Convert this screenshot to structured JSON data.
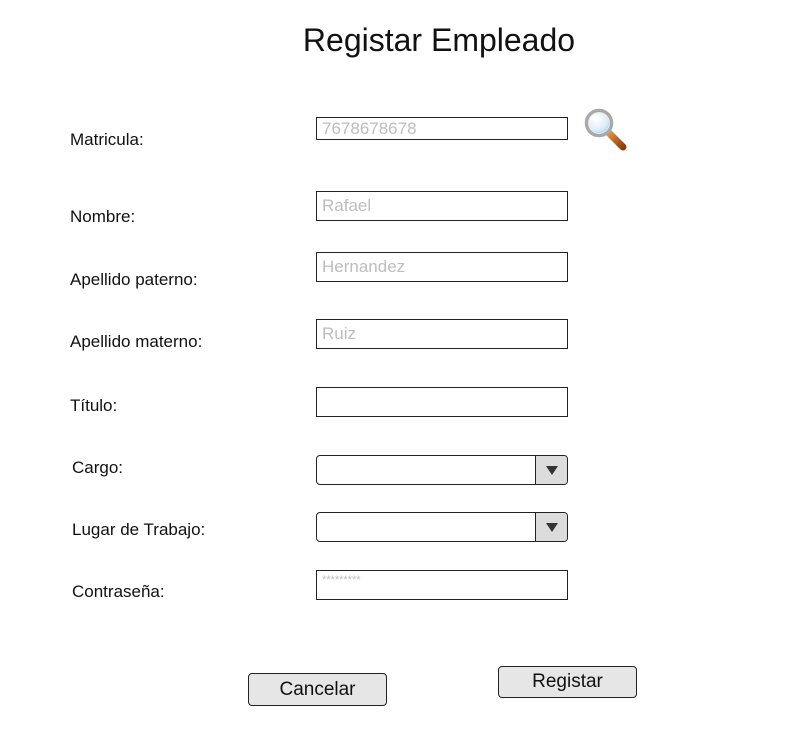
{
  "title": "Registar Empleado",
  "form": {
    "matricula": {
      "label": "Matricula:",
      "placeholder": "7678678678"
    },
    "nombre": {
      "label": "Nombre:",
      "placeholder": "Rafael"
    },
    "apellido_paterno": {
      "label": "Apellido paterno:",
      "placeholder": "Hernandez"
    },
    "apellido_materno": {
      "label": "Apellido materno:",
      "placeholder": "Ruiz"
    },
    "titulo": {
      "label": "Título:",
      "placeholder": ""
    },
    "cargo": {
      "label": "Cargo:",
      "selected": ""
    },
    "lugar_trabajo": {
      "label": "Lugar de Trabajo:",
      "selected": ""
    },
    "contrasena": {
      "label": "Contraseña:",
      "placeholder": "*********"
    }
  },
  "buttons": {
    "cancel": "Cancelar",
    "register": "Registar"
  },
  "icons": {
    "search": "magnifier-icon",
    "dropdown": "chevron-down-icon"
  },
  "colors": {
    "placeholder": "#bdbdbd",
    "button_bg": "#e6e6e6",
    "dropdown_bg": "#dcdcdc"
  }
}
